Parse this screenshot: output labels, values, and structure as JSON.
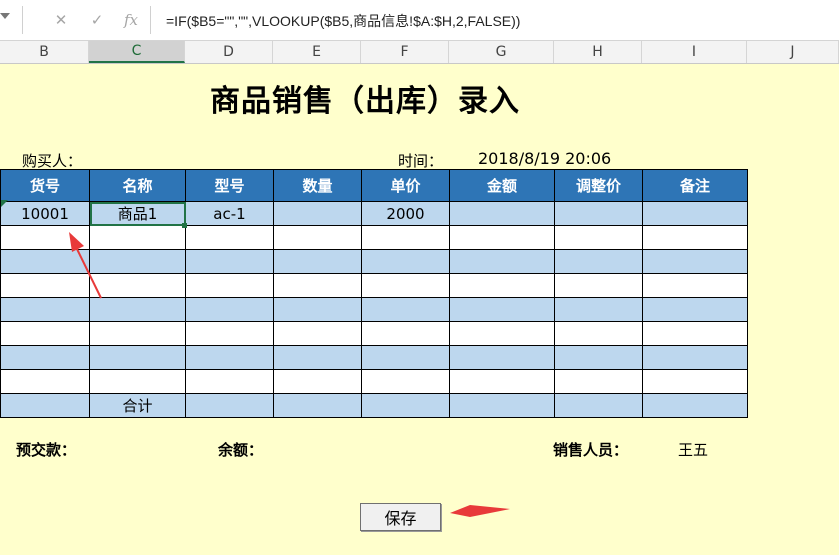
{
  "formula_bar": {
    "formula": "=IF($B5=\"\",\"\",VLOOKUP($B5,商品信息!$A:$H,2,FALSE))"
  },
  "columns": [
    "B",
    "C",
    "D",
    "E",
    "F",
    "G",
    "H",
    "I",
    "J"
  ],
  "sheet": {
    "title": "商品销售（出库）录入",
    "buyer_label": "购买人：",
    "time_label": "时间：",
    "time_value": "2018/8/19 20:06"
  },
  "table": {
    "headers": [
      "货号",
      "名称",
      "型号",
      "数量",
      "单价",
      "金额",
      "调整价",
      "备注"
    ],
    "rows": [
      [
        "10001",
        "商品1",
        "ac-1",
        "",
        "2000",
        "",
        "",
        ""
      ],
      [
        "",
        "",
        "",
        "",
        "",
        "",
        "",
        ""
      ],
      [
        "",
        "",
        "",
        "",
        "",
        "",
        "",
        ""
      ],
      [
        "",
        "",
        "",
        "",
        "",
        "",
        "",
        ""
      ],
      [
        "",
        "",
        "",
        "",
        "",
        "",
        "",
        ""
      ],
      [
        "",
        "",
        "",
        "",
        "",
        "",
        "",
        ""
      ],
      [
        "",
        "",
        "",
        "",
        "",
        "",
        "",
        ""
      ],
      [
        "",
        "",
        "",
        "",
        "",
        "",
        "",
        ""
      ]
    ],
    "total_label": "合计"
  },
  "footer": {
    "prepay_label": "预交款：",
    "balance_label": "余额：",
    "sales_label": "销售人员：",
    "sales_value": "王五"
  },
  "save_button": "保存",
  "colors": {
    "header_bg": "#2e75b6",
    "row_blue": "#bdd7ee",
    "sheet_bg": "#ffffcc",
    "arrow": "#e83a3a"
  }
}
